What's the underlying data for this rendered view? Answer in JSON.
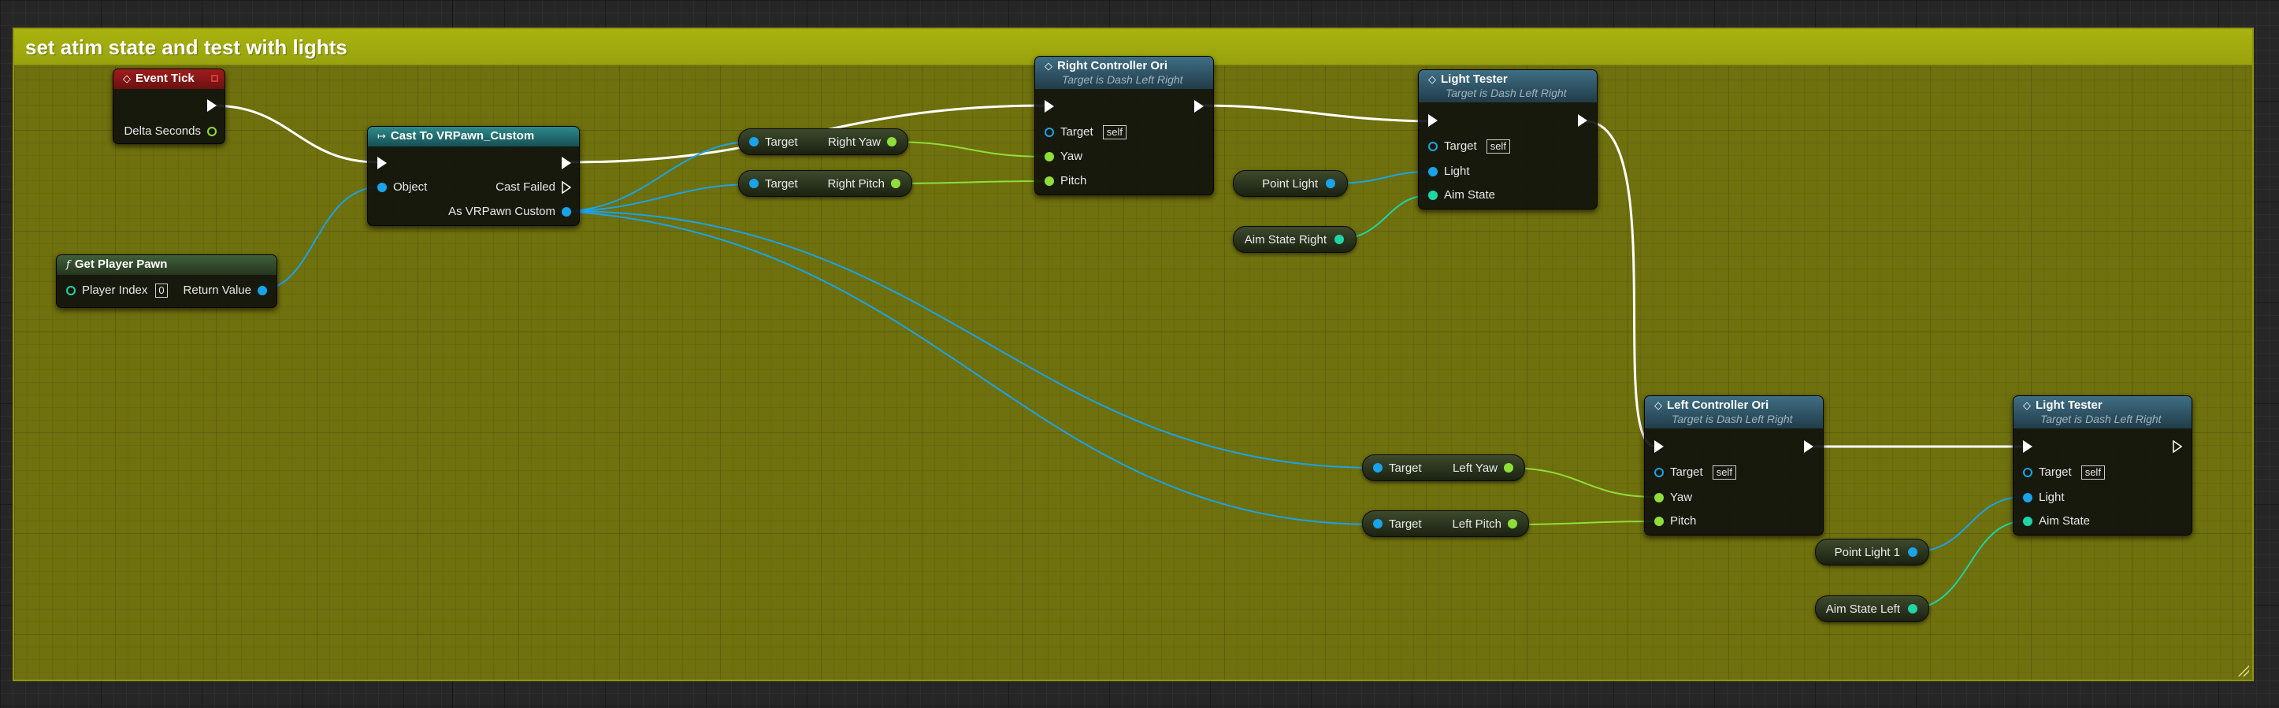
{
  "comment": {
    "title": "set atim state and test with lights"
  },
  "nodes": {
    "event_tick": {
      "title": "Event Tick",
      "delta_seconds": "Delta Seconds"
    },
    "get_player_pawn": {
      "title": "Get Player Pawn",
      "player_index_label": "Player Index",
      "player_index_value": "0",
      "return_value": "Return Value"
    },
    "cast": {
      "title": "Cast To VRPawn_Custom",
      "object": "Object",
      "cast_failed": "Cast Failed",
      "as_pawn": "As VRPawn Custom"
    },
    "right_yaw": {
      "target": "Target",
      "output": "Right Yaw"
    },
    "right_pitch": {
      "target": "Target",
      "output": "Right Pitch"
    },
    "right_controller_ori": {
      "title": "Right Controller Ori",
      "subtitle": "Target is Dash Left Right",
      "target": "Target",
      "self": "self",
      "yaw": "Yaw",
      "pitch": "Pitch"
    },
    "point_light": {
      "label": "Point Light"
    },
    "aim_state_right": {
      "label": "Aim State Right"
    },
    "light_tester_1": {
      "title": "Light Tester",
      "subtitle": "Target is Dash Left Right",
      "target": "Target",
      "self": "self",
      "light": "Light",
      "aim_state": "Aim State"
    },
    "left_yaw": {
      "target": "Target",
      "output": "Left Yaw"
    },
    "left_pitch": {
      "target": "Target",
      "output": "Left Pitch"
    },
    "left_controller_ori": {
      "title": "Left Controller Ori",
      "subtitle": "Target is Dash Left Right",
      "target": "Target",
      "self": "self",
      "yaw": "Yaw",
      "pitch": "Pitch"
    },
    "point_light_1": {
      "label": "Point Light 1"
    },
    "aim_state_left": {
      "label": "Aim State Left"
    },
    "light_tester_2": {
      "title": "Light Tester",
      "subtitle": "Target is Dash Left Right",
      "target": "Target",
      "self": "self",
      "light": "Light",
      "aim_state": "Aim State"
    }
  },
  "colors": {
    "comment_bg": "#6f700e",
    "comment_header": "#a8b30f",
    "exec_wire": "#ffffff",
    "object_wire": "#1aa3e8",
    "float_wire": "#8fde3a",
    "enum_wire": "#1ed5a6"
  },
  "icons": {
    "event": "event-diamond-icon",
    "function": "function-f-icon",
    "cast": "cast-arrows-icon"
  }
}
